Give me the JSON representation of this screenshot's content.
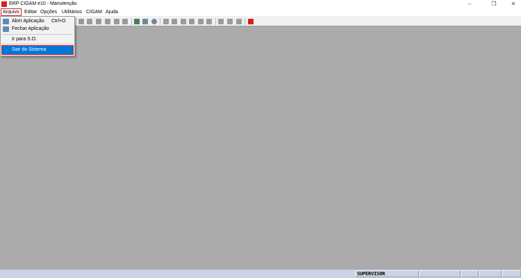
{
  "window": {
    "title": "ERP CIGAM e10 - Manutenção",
    "minimize": "–",
    "restore": "❐",
    "close": "✕"
  },
  "menubar": [
    "Arquivo",
    "Editar",
    "Opções",
    "Utilitários",
    "CIGAM",
    "Ajuda"
  ],
  "dropdown": {
    "items": [
      {
        "label": "Abrir Aplicação",
        "shortcut": "Ctrl+O",
        "icon": "open-app-icon"
      },
      {
        "label": "Fechar Aplicação",
        "icon": "close-app-icon"
      },
      {
        "label": "Ir para S.O."
      },
      {
        "label": "Sair do Sistema",
        "highlighted": true
      }
    ]
  },
  "status": {
    "user": "SUPERVISOR"
  },
  "colors": {
    "highlight": "#0078d7",
    "annotation": "#e0202a",
    "workspace": "#ababab",
    "status": "#c9d3e2"
  }
}
